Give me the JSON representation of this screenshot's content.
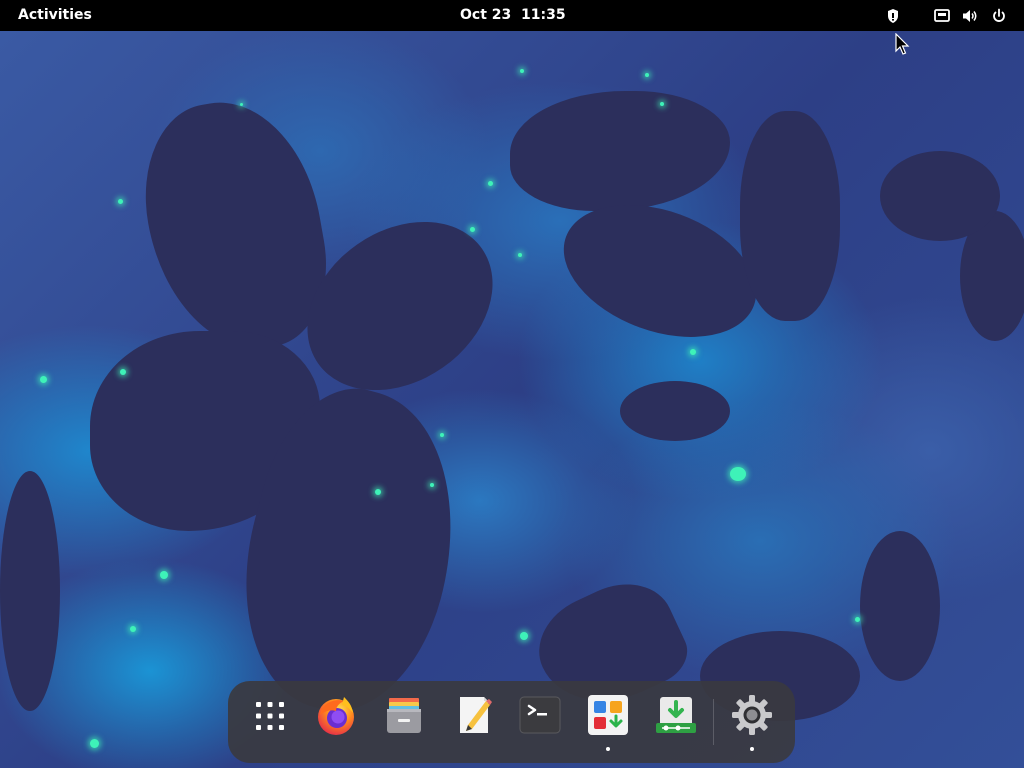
{
  "topbar": {
    "activities_label": "Activities",
    "clock_label": "Oct 23  11:35",
    "tray_icons": [
      "security-shield-icon",
      "network-wired-icon",
      "volume-icon",
      "power-icon"
    ]
  },
  "dock": {
    "items": [
      {
        "name": "show-apps",
        "icon": "app-grid-icon",
        "running": false
      },
      {
        "name": "firefox",
        "icon": "firefox-icon",
        "running": false
      },
      {
        "name": "files",
        "icon": "files-icon",
        "running": false
      },
      {
        "name": "text-editor",
        "icon": "text-editor-icon",
        "running": false
      },
      {
        "name": "terminal",
        "icon": "terminal-icon",
        "running": false
      },
      {
        "name": "software",
        "icon": "software-center-icon",
        "running": true
      },
      {
        "name": "installer",
        "icon": "installer-icon",
        "running": false
      },
      {
        "name": "settings",
        "icon": "settings-gear-icon",
        "running": true
      }
    ]
  },
  "colors": {
    "topbar_bg": "#000000",
    "dock_bg": "#3a3a40",
    "wallpaper_dark": "#2c2f5c",
    "wallpaper_blue": "#1f86cc",
    "wallpaper_glow": "#3ef2b8"
  }
}
